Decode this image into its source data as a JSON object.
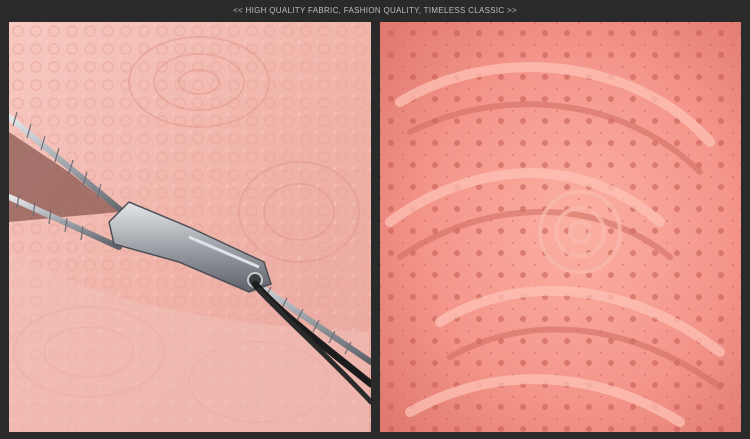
{
  "banner": {
    "text": "<< HIGH QUALITY FABRIC, FASHION QUALITY, TIMELESS CLASSIC >>"
  },
  "panels": {
    "left": {
      "subject": "pink-lace-zipper-closeup-photo"
    },
    "right": {
      "subject": "coral-lace-fabric-closeup-photo"
    }
  },
  "colors": {
    "background": "#2a2a2a",
    "banner_text": "#bdbdbd",
    "left_lace": "#f2b6ae",
    "right_lace": "#f59a8c",
    "zipper_metal": "#b9bcc2",
    "zipper_cord": "#1c1c1c"
  }
}
